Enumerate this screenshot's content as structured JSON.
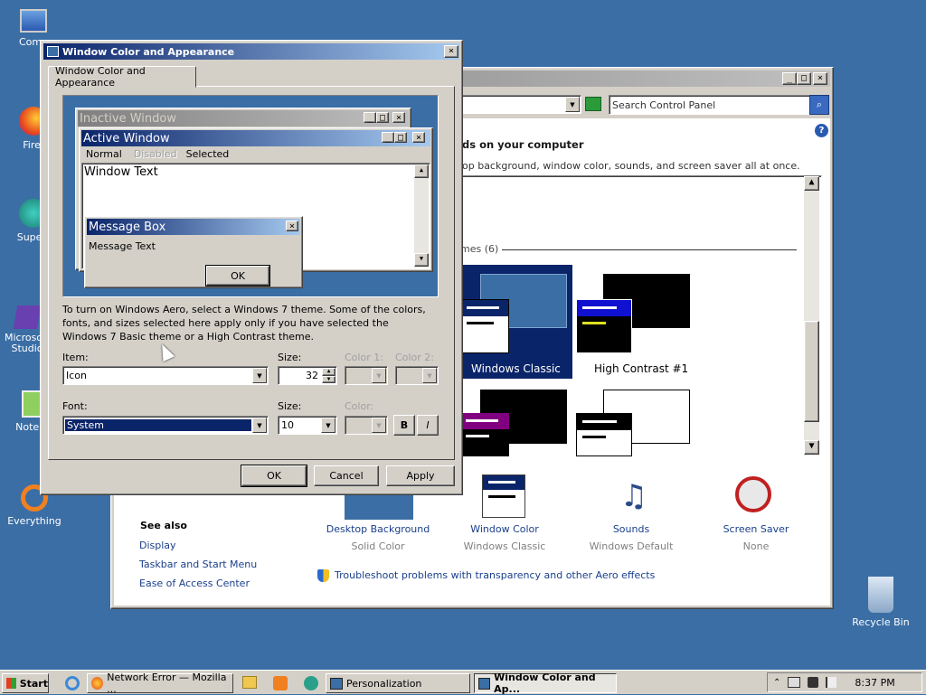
{
  "desktop": {
    "icons": [
      {
        "label": "Comp"
      },
      {
        "label": "Firef"
      },
      {
        "label": "Superr"
      },
      {
        "label": "Microsoft Studio"
      },
      {
        "label": "Notepa"
      },
      {
        "label": "Everything"
      },
      {
        "label": "Recycle Bin"
      }
    ]
  },
  "control_panel": {
    "search_placeholder": "Search Control Panel",
    "heading": "ds on your computer",
    "subheading": "op background, window color, sounds, and screen saver all at once.",
    "themes_group": "mes (6)",
    "themes": [
      {
        "label": "Windows Classic"
      },
      {
        "label": "High Contrast #1"
      }
    ],
    "see_also_title": "See also",
    "see_also": [
      "Display",
      "Taskbar and Start Menu",
      "Ease of Access Center"
    ],
    "bottom_items": [
      {
        "label": "Desktop Background",
        "value": "Solid Color"
      },
      {
        "label": "Window Color",
        "value": "Windows Classic"
      },
      {
        "label": "Sounds",
        "value": "Windows Default"
      },
      {
        "label": "Screen Saver",
        "value": "None"
      }
    ],
    "troubleshoot": "Troubleshoot problems with transparency and other Aero effects"
  },
  "dialog": {
    "title": "Window Color and Appearance",
    "tab": "Window Color and Appearance",
    "preview": {
      "inactive_title": "Inactive Window",
      "active_title": "Active Window",
      "menu_normal": "Normal",
      "menu_disabled": "Disabled",
      "menu_selected": "Selected",
      "window_text": "Window Text",
      "msgbox_title": "Message Box",
      "msgbox_text": "Message Text",
      "msgbox_ok": "OK"
    },
    "info_text": "To turn on Windows Aero, select a Windows 7 theme.  Some of the colors, fonts, and sizes selected here apply only if you have selected the Windows 7 Basic theme or a High Contrast theme.",
    "item_label": "Item:",
    "item_value": "Icon",
    "size_label": "Size:",
    "size_value": "32",
    "color1_label": "Color 1:",
    "color2_label": "Color 2:",
    "font_label": "Font:",
    "font_value": "System",
    "font_size_label": "Size:",
    "font_size_value": "10",
    "font_color_label": "Color:",
    "bold": "B",
    "italic": "I",
    "ok": "OK",
    "cancel": "Cancel",
    "apply": "Apply"
  },
  "taskbar": {
    "start": "Start",
    "items": [
      {
        "label": "Network Error — Mozilla ..."
      },
      {
        "label": "Personalization"
      },
      {
        "label": "Window Color and Ap..."
      }
    ],
    "clock": "8:37 PM"
  },
  "colors": {
    "desktop": "#3b6ea5",
    "active_title_start": "#0a246a",
    "active_title_end": "#a6caf0",
    "inactive_title_start": "#808080",
    "inactive_title_end": "#c0c0c0",
    "face": "#d4d0c8"
  }
}
